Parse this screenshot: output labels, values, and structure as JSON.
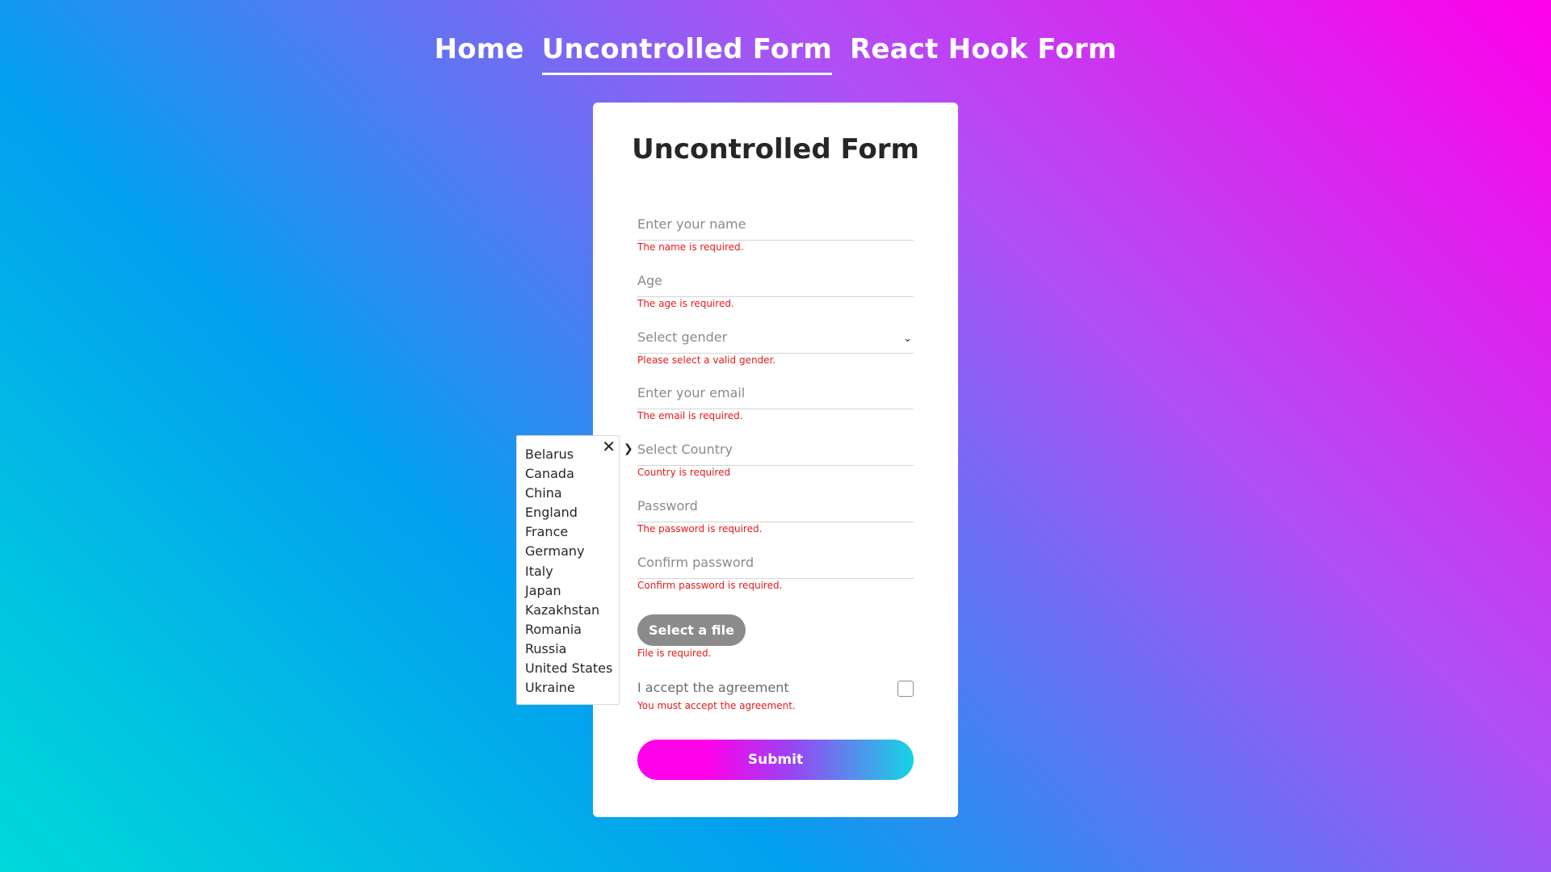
{
  "nav": {
    "items": [
      {
        "label": "Home"
      },
      {
        "label": "Uncontrolled Form"
      },
      {
        "label": "React Hook Form"
      }
    ]
  },
  "form": {
    "title": "Uncontrolled Form",
    "name": {
      "placeholder": "Enter your name",
      "value": "",
      "error": "The name is required."
    },
    "age": {
      "placeholder": "Age",
      "value": "",
      "error": "The age is required."
    },
    "gender": {
      "placeholder": "Select gender",
      "error": "Please select a valid gender."
    },
    "email": {
      "placeholder": "Enter your email",
      "value": "",
      "error": "The email is required."
    },
    "country": {
      "placeholder": "Select Country",
      "error": "Country is required"
    },
    "password": {
      "placeholder": "Password",
      "value": "",
      "error": "The password is required."
    },
    "confirm": {
      "placeholder": "Confirm password",
      "value": "",
      "error": "Confirm password is required."
    },
    "file": {
      "button_label": "Select a file",
      "error": "File is required."
    },
    "agreement": {
      "label": "I accept the agreement",
      "checked": false,
      "error": "You must accept the agreement."
    },
    "submit_label": "Submit"
  },
  "country_dropdown": {
    "close_icon": "close-icon",
    "options": [
      "Belarus",
      "Canada",
      "China",
      "England",
      "France",
      "Germany",
      "Italy",
      "Japan",
      "Kazakhstan",
      "Romania",
      "Russia",
      "United States",
      "Ukraine"
    ]
  },
  "colors": {
    "error": "#e81919",
    "gradient_pink": "#ff00e9",
    "gradient_cyan": "#00d9d9",
    "gradient_blue": "#039fef"
  }
}
